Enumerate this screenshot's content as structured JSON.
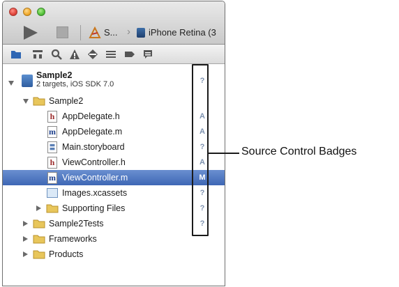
{
  "toolbar": {
    "scheme_label": "S...",
    "device_label": "iPhone Retina (3"
  },
  "navigator": {
    "icons": [
      "folder-icon",
      "hierarchy-icon",
      "search-icon",
      "warning-icon",
      "diamond-icon",
      "list-icon",
      "tag-icon",
      "comment-icon"
    ]
  },
  "project": {
    "name": "Sample2",
    "subtitle": "2 targets, iOS SDK 7.0",
    "badge": "?"
  },
  "items": [
    {
      "label": "Sample2",
      "badge": ""
    },
    {
      "label": "AppDelegate.h",
      "badge": "A"
    },
    {
      "label": "AppDelegate.m",
      "badge": "A"
    },
    {
      "label": "Main.storyboard",
      "badge": "?"
    },
    {
      "label": "ViewController.h",
      "badge": "A"
    },
    {
      "label": "ViewController.m",
      "badge": "M"
    },
    {
      "label": "Images.xcassets",
      "badge": "?"
    },
    {
      "label": "Supporting Files",
      "badge": "?"
    },
    {
      "label": "Sample2Tests",
      "badge": "?"
    },
    {
      "label": "Frameworks",
      "badge": ""
    },
    {
      "label": "Products",
      "badge": ""
    }
  ],
  "file_letters": {
    "h": "h",
    "m": "m"
  },
  "callout": {
    "label": "Source Control Badges"
  },
  "colors": {
    "selection": "#3e67b5",
    "badge": "#7f93b0",
    "folder": "#e8c65b"
  }
}
